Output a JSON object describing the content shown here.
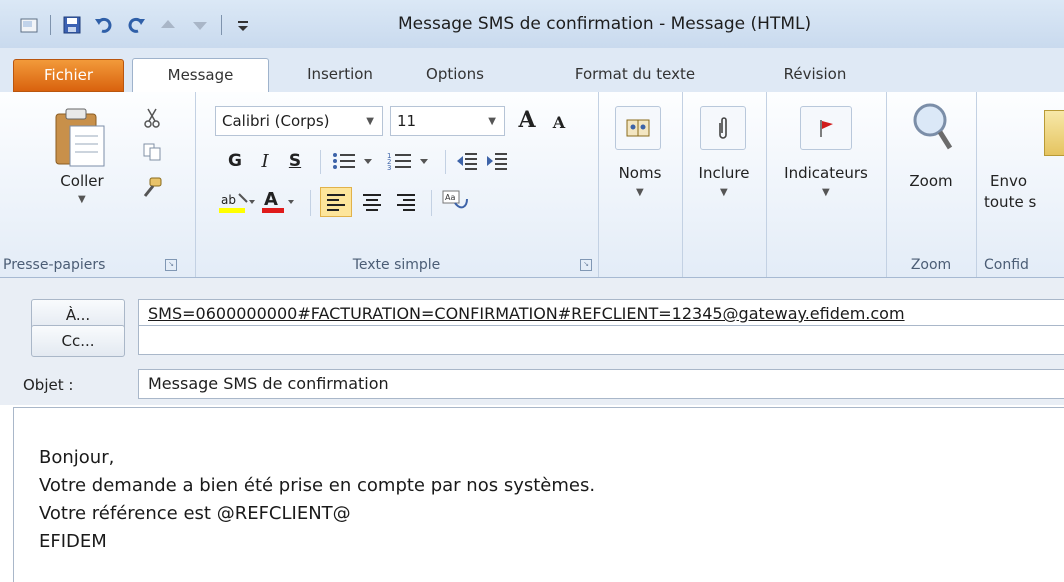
{
  "window": {
    "title": "Message SMS de confirmation  -  Message (HTML)",
    "qat_icons": [
      "app-menu-icon",
      "save-icon",
      "undo-icon",
      "redo-icon",
      "up-arrow-icon",
      "down-arrow-icon",
      "customize-icon"
    ]
  },
  "tabs": [
    "Fichier",
    "Message",
    "Insertion",
    "Options",
    "Format du texte",
    "Révision"
  ],
  "ribbon": {
    "clipboard": {
      "paste_label": "Coller",
      "group_label": "Presse-papiers"
    },
    "font": {
      "font_name": "Calibri (Corps)",
      "font_size": "11",
      "grow_label": "A",
      "shrink_label": "A",
      "bold": "G",
      "italic": "I",
      "underline": "S",
      "group_label": "Texte simple"
    },
    "names": {
      "label": "Noms"
    },
    "include": {
      "label": "Inclure"
    },
    "flags": {
      "label": "Indicateurs"
    },
    "zoom": {
      "label": "Zoom",
      "group_label": "Zoom"
    },
    "send": {
      "label_line1": "Envo",
      "label_line2": "toute s",
      "group_label": "Confid"
    }
  },
  "header": {
    "to_button": "À...",
    "to_value": "SMS=0600000000#FACTURATION=CONFIRMATION#REFCLIENT=12345@gateway.efidem.com",
    "cc_button": "Cc...",
    "cc_value": "",
    "subject_label": "Objet :",
    "subject_value": "Message SMS de confirmation"
  },
  "body": {
    "lines": [
      "Bonjour,",
      "Votre demande a bien été prise en compte par nos systèmes.",
      "Votre référence est @REFCLIENT@",
      "EFIDEM"
    ]
  },
  "colors": {
    "file_tab": "#e2731c",
    "ribbon_bg": "#e3ecf7",
    "header_bg": "#e9eef5"
  }
}
